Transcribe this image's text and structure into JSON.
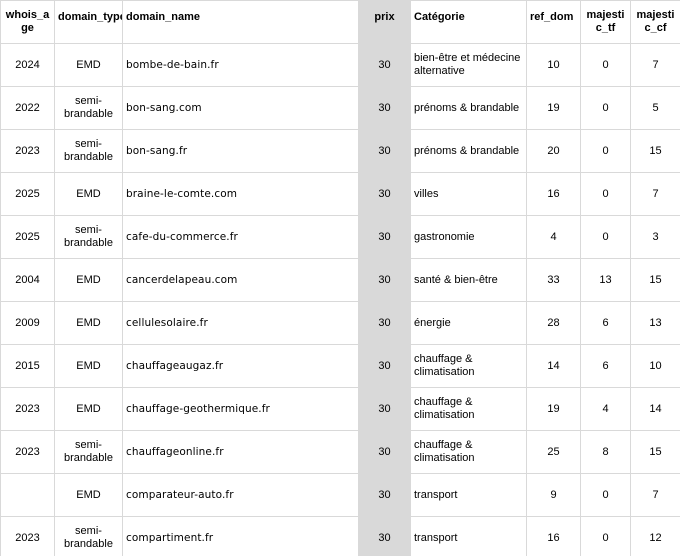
{
  "headers": {
    "whois_age": "whois_age",
    "domain_type": "domain_type",
    "domain_name": "domain_name",
    "prix": "prix",
    "categorie": "Catégorie",
    "ref_dom": "ref_dom",
    "majestic_tf": "majestic_tf",
    "majestic_cf": "majestic_cf"
  },
  "rows": [
    {
      "whois_age": "2024",
      "domain_type": "EMD",
      "domain_name": "bombe-de-bain.fr",
      "prix": "30",
      "categorie": "bien-être et médecine alternative",
      "ref_dom": "10",
      "majestic_tf": "0",
      "majestic_cf": "7"
    },
    {
      "whois_age": "2022",
      "domain_type": "semi-brandable",
      "domain_name": "bon-sang.com",
      "prix": "30",
      "categorie": "prénoms & brandable",
      "ref_dom": "19",
      "majestic_tf": "0",
      "majestic_cf": "5"
    },
    {
      "whois_age": "2023",
      "domain_type": "semi-brandable",
      "domain_name": "bon-sang.fr",
      "prix": "30",
      "categorie": "prénoms & brandable",
      "ref_dom": "20",
      "majestic_tf": "0",
      "majestic_cf": "15"
    },
    {
      "whois_age": "2025",
      "domain_type": "EMD",
      "domain_name": "braine-le-comte.com",
      "prix": "30",
      "categorie": "villes",
      "ref_dom": "16",
      "majestic_tf": "0",
      "majestic_cf": "7"
    },
    {
      "whois_age": "2025",
      "domain_type": "semi-brandable",
      "domain_name": "cafe-du-commerce.fr",
      "prix": "30",
      "categorie": "gastronomie",
      "ref_dom": "4",
      "majestic_tf": "0",
      "majestic_cf": "3"
    },
    {
      "whois_age": "2004",
      "domain_type": "EMD",
      "domain_name": "cancerdelapeau.com",
      "prix": "30",
      "categorie": "santé & bien-être",
      "ref_dom": "33",
      "majestic_tf": "13",
      "majestic_cf": "15"
    },
    {
      "whois_age": "2009",
      "domain_type": "EMD",
      "domain_name": "cellulesolaire.fr",
      "prix": "30",
      "categorie": "énergie",
      "ref_dom": "28",
      "majestic_tf": "6",
      "majestic_cf": "13"
    },
    {
      "whois_age": "2015",
      "domain_type": "EMD",
      "domain_name": "chauffageaugaz.fr",
      "prix": "30",
      "categorie": "chauffage & climatisation",
      "ref_dom": "14",
      "majestic_tf": "6",
      "majestic_cf": "10"
    },
    {
      "whois_age": "2023",
      "domain_type": "EMD",
      "domain_name": "chauffage-geothermique.fr",
      "prix": "30",
      "categorie": "chauffage & climatisation",
      "ref_dom": "19",
      "majestic_tf": "4",
      "majestic_cf": "14"
    },
    {
      "whois_age": "2023",
      "domain_type": "semi-brandable",
      "domain_name": "chauffageonline.fr",
      "prix": "30",
      "categorie": "chauffage & climatisation",
      "ref_dom": "25",
      "majestic_tf": "8",
      "majestic_cf": "15"
    },
    {
      "whois_age": "",
      "domain_type": "EMD",
      "domain_name": "comparateur-auto.fr",
      "prix": "30",
      "categorie": "transport",
      "ref_dom": "9",
      "majestic_tf": "0",
      "majestic_cf": "7"
    },
    {
      "whois_age": "2023",
      "domain_type": "semi-brandable",
      "domain_name": "compartiment.fr",
      "prix": "30",
      "categorie": "transport",
      "ref_dom": "16",
      "majestic_tf": "0",
      "majestic_cf": "12"
    }
  ]
}
